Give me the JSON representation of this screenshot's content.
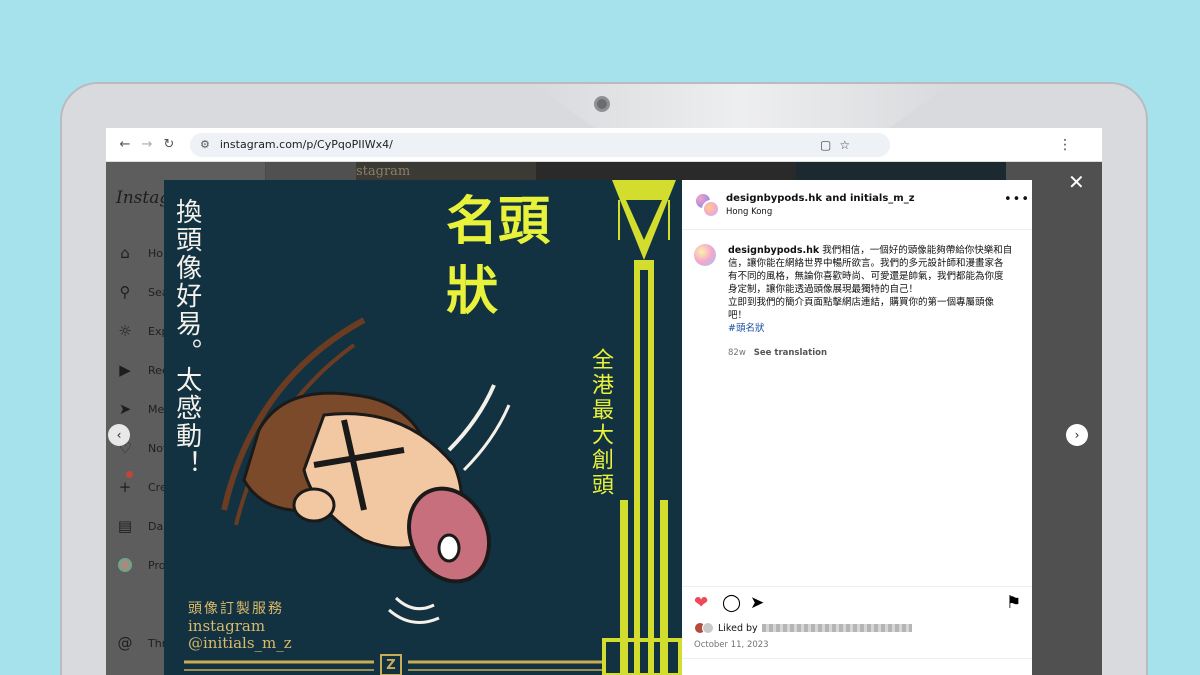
{
  "browser": {
    "url": "instagram.com/p/CyPqoPIIWx4/",
    "back_icon": "arrow-left-icon",
    "forward_icon": "arrow-right-icon",
    "reload_icon": "reload-icon"
  },
  "sidebar": {
    "logo": "Instag",
    "items": [
      {
        "label": "Hom",
        "icon": "home-icon"
      },
      {
        "label": "Sear",
        "icon": "search-icon"
      },
      {
        "label": "Expl",
        "icon": "compass-icon"
      },
      {
        "label": "Reel",
        "icon": "reels-icon"
      },
      {
        "label": "Mes",
        "icon": "send-icon"
      },
      {
        "label": "Noti",
        "icon": "heart-icon"
      },
      {
        "label": "Crea",
        "icon": "plus-icon"
      },
      {
        "label": "Das",
        "icon": "chart-icon"
      },
      {
        "label": "Prof",
        "icon": "avatar-icon"
      },
      {
        "label": "Thre",
        "icon": "threads-icon"
      }
    ]
  },
  "background_thumb": {
    "text": "stagram"
  },
  "post_image": {
    "handwritten": "換頭像好易。太感動！",
    "title_line1": "名頭",
    "title_line2": "狀",
    "slogan": "全港最大創頭",
    "service_label": "頭像訂製服務",
    "service_platform": "instagram",
    "service_handle": "@initials_m_z",
    "z_mark": "Z"
  },
  "post": {
    "header_name": "designbypods.hk and initials_m_z",
    "location": "Hong Kong",
    "caption_user": "designbypods.hk",
    "caption_lines": [
      "我們相信，一個好的頭像能夠帶給你快樂和自",
      "信，讓你能在網絡世界中暢所欲言。我們的多元設計師和漫畫家各",
      "有不同的風格，無論你喜歡時尚、可愛還是帥氣，我們都能為你度",
      "身定制，讓你能透過頭像展現最獨特的自己！",
      "立即到我們的簡介頁面點擊網店連結，購買你的第一個專屬頭像",
      "吧！"
    ],
    "hashtag": "#頭名狀",
    "age": "82w",
    "see_translation": "See translation",
    "liked_by": "Liked by",
    "date": "October 11, 2023"
  },
  "colors": {
    "like_red": "#ed4956",
    "poster_bg": "#123241",
    "poster_yellow": "#e9f23a",
    "poster_gold": "#c9ad55"
  }
}
